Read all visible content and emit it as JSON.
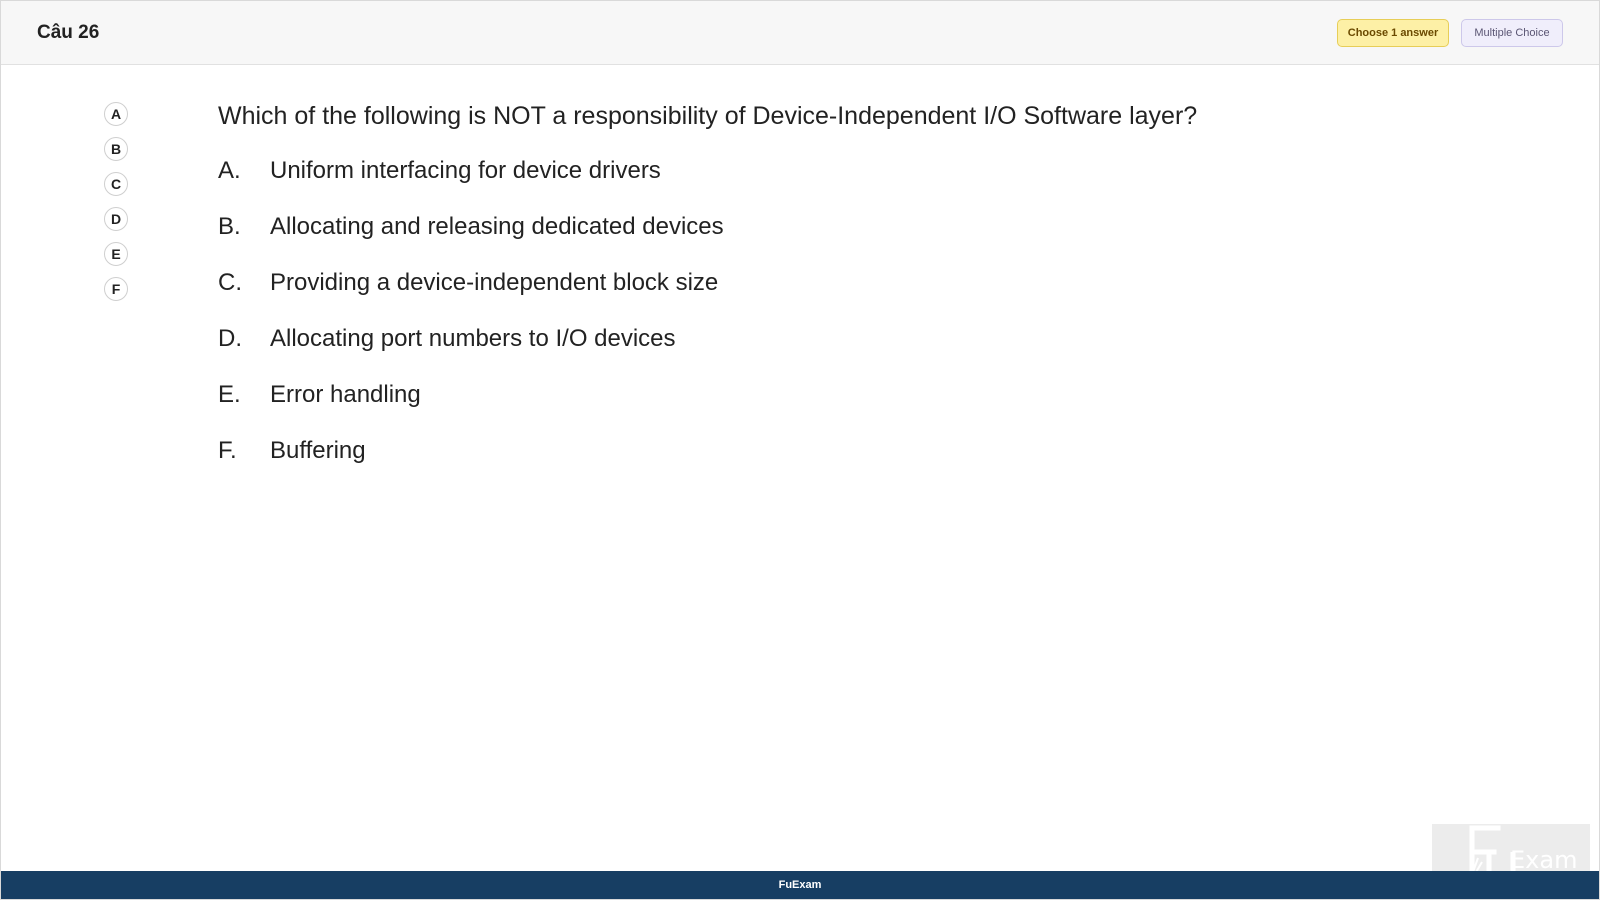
{
  "header": {
    "question_number": "Câu 26",
    "badge_choose": "Choose 1 answer",
    "badge_type": "Multiple Choice"
  },
  "choices": [
    "A",
    "B",
    "C",
    "D",
    "E",
    "F"
  ],
  "question": {
    "text": "Which of the following is NOT a responsibility of Device-Independent I/O Software layer?",
    "options": [
      {
        "letter": "A.",
        "text": "Uniform interfacing for device drivers"
      },
      {
        "letter": "B.",
        "text": "Allocating and releasing dedicated devices"
      },
      {
        "letter": "C.",
        "text": "Providing a device-independent block size"
      },
      {
        "letter": "D.",
        "text": "Allocating port numbers to I/O devices"
      },
      {
        "letter": "E.",
        "text": "Error handling"
      },
      {
        "letter": "F.",
        "text": "Buffering"
      }
    ]
  },
  "watermark": {
    "logo_text": "FU",
    "logo_subtext": "Exam"
  },
  "footer": {
    "brand": "FuExam"
  },
  "colors": {
    "footer_bg": "#173e63",
    "choose_badge_bg": "#fdf0a6",
    "type_badge_bg": "#f0eefb"
  }
}
